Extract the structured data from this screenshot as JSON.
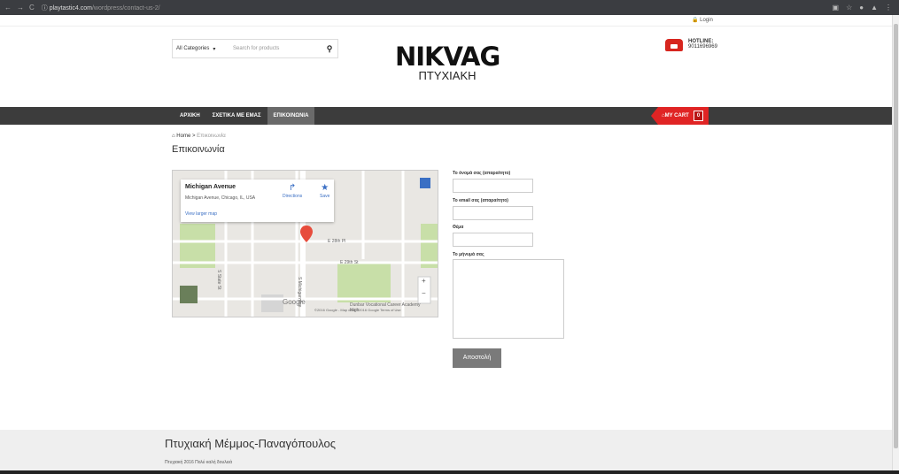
{
  "browser": {
    "url_host": "playtastic4.com",
    "url_path": "/wordpress/contact-us-2/"
  },
  "topbar": {
    "login": "🔒 Login"
  },
  "search": {
    "category": "All Categories",
    "placeholder": "Search for products"
  },
  "logo": {
    "line1": "NIKVAG",
    "line2": "ΠΤΥΧΙΑΚΗ"
  },
  "hotline": {
    "label": "HOTLINE:",
    "number": "9011696969"
  },
  "nav": {
    "items": [
      "ΑΡΧΙΚΗ",
      "ΣΧΕΤΙΚΑ ΜΕ ΕΜΑΣ",
      "ΕΠΙΚΟΙΝΩΝΙΑ"
    ],
    "cart_label": "MY CART",
    "cart_count": "0"
  },
  "breadcrumb": {
    "home": "Home",
    "sep": ">",
    "current": "Επικοινωνία"
  },
  "page_title": "Επικοινωνία",
  "map": {
    "place": "Michigan Avenue",
    "address": "Michigan Avenue, Chicago, IL, USA",
    "view_larger": "View larger map",
    "directions": "Directions",
    "save": "Save",
    "labels": [
      "E 28th Pl",
      "E 29th St",
      "S State St",
      "S Michigan Ave",
      "Dunbar Vocational Career Academy High"
    ],
    "attribution": "©2016 Google - Map data ©2016 Google   Terms of Use",
    "google": "Google"
  },
  "form": {
    "name_label": "Το όνομά σας (απαραίτητο)",
    "email_label": "Το email σας (απαραίτητο)",
    "subject_label": "Θέμα",
    "message_label": "Το μήνυμά σας",
    "submit": "Αποστολή"
  },
  "footer": {
    "title": "Πτυχιακή Μέμμος-Παναγόπουλος",
    "subtitle": "Πτυχιακή 2016 Πολύ καλή δουλειά"
  },
  "colors": {
    "accent": "#e02424",
    "navbar": "#3c3c3c",
    "button": "#7a7a7a"
  }
}
